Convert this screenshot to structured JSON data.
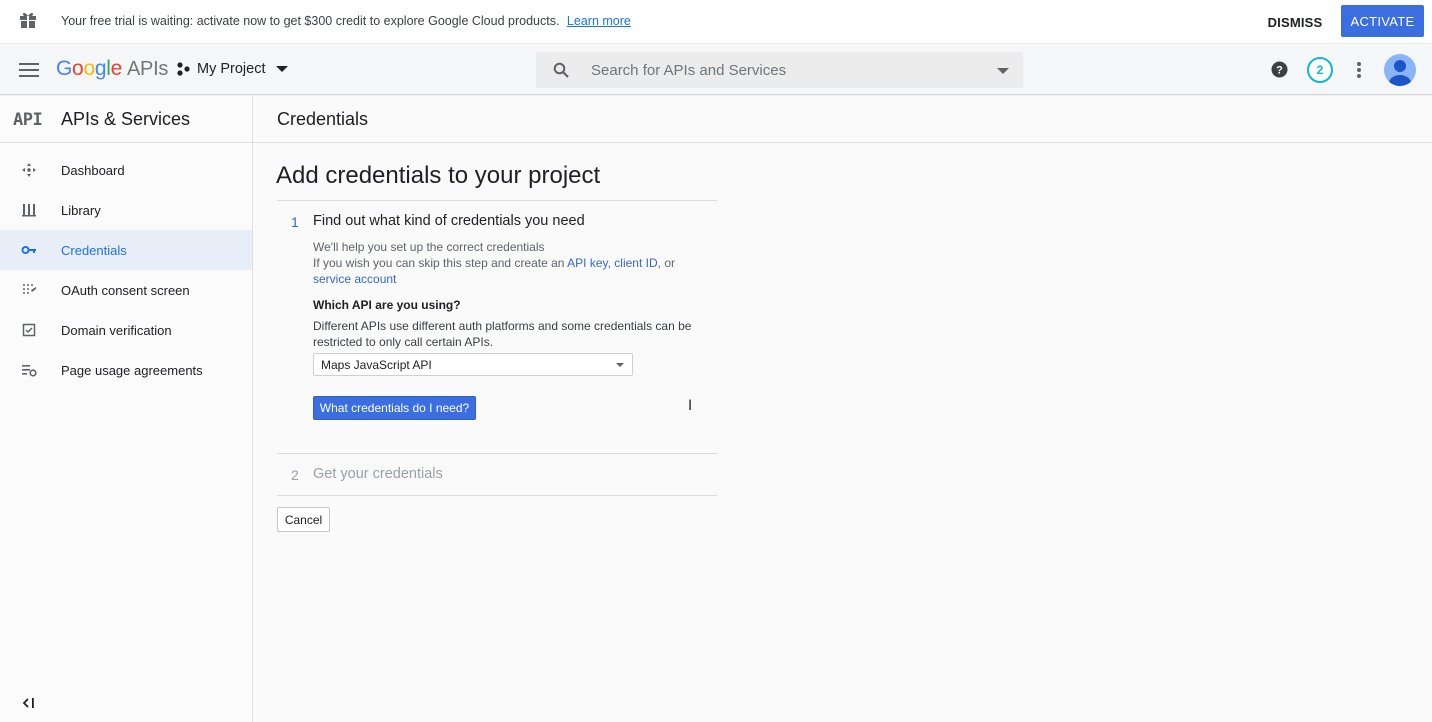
{
  "banner": {
    "message": "Your free trial is waiting: activate now to get $300 credit to explore Google Cloud products.",
    "learn_more": "Learn more",
    "dismiss": "DISMISS",
    "activate": "ACTIVATE"
  },
  "header": {
    "logo_g": "G",
    "logo_o1": "o",
    "logo_o2": "o",
    "logo_g2": "g",
    "logo_l": "l",
    "logo_e": "e",
    "logo_apis": "APIs",
    "project": "My Project",
    "search_placeholder": "Search for APIs and Services",
    "notification_count": "2"
  },
  "sidebar": {
    "title": "APIs & Services",
    "api_logo": "API",
    "items": [
      {
        "label": "Dashboard",
        "icon": "dashboard-icon"
      },
      {
        "label": "Library",
        "icon": "library-icon"
      },
      {
        "label": "Credentials",
        "icon": "key-icon",
        "active": true
      },
      {
        "label": "OAuth consent screen",
        "icon": "consent-icon"
      },
      {
        "label": "Domain verification",
        "icon": "checkbox-icon"
      },
      {
        "label": "Page usage agreements",
        "icon": "settings-list-icon"
      }
    ]
  },
  "breadcrumb": "Credentials",
  "main": {
    "title": "Add credentials to your project",
    "step1": {
      "number": "1",
      "title": "Find out what kind of credentials you need",
      "line1": "We'll help you set up the correct credentials",
      "line2_pre": "If you wish you can skip this step and create an ",
      "api_key": "API key",
      "comma": ", ",
      "client_id": "client ID",
      "or": ", or",
      "service_account": "service account",
      "question": "Which API are you using?",
      "description": "Different APIs use different auth platforms and some credentials can be restricted to only call certain APIs.",
      "selected_api": "Maps JavaScript API",
      "button": "What credentials do I need?"
    },
    "step2": {
      "number": "2",
      "title": "Get your credentials"
    },
    "cancel": "Cancel"
  },
  "colors": {
    "accent": "#3b6fe0",
    "link": "#1a73e8",
    "notification_ring": "#12b5cb"
  }
}
